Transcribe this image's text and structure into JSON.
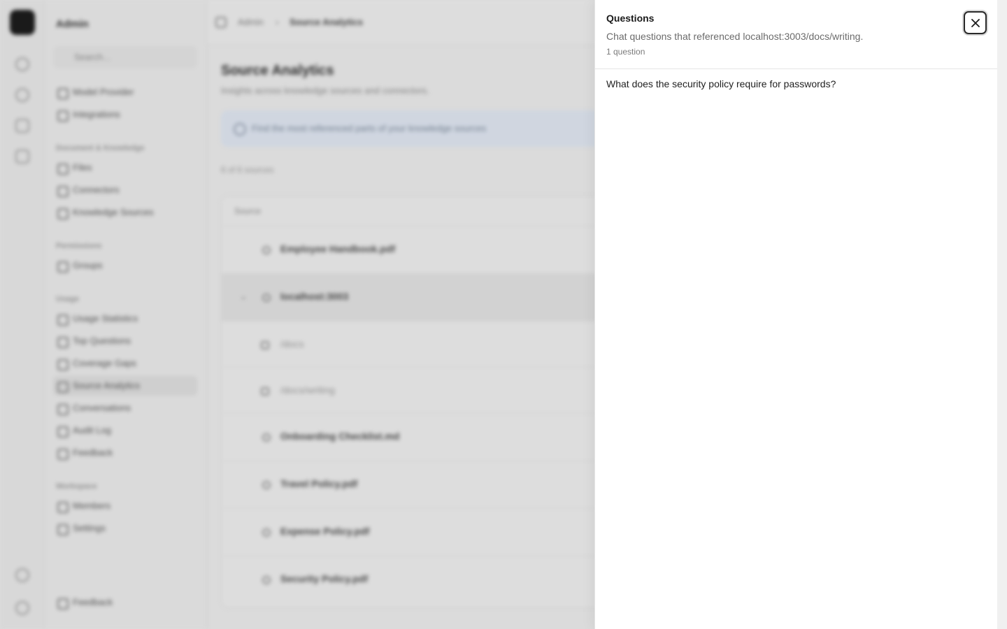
{
  "background": {
    "workspace_name": "Admin",
    "search_placeholder": "Search...",
    "sidebar": {
      "top_items": [
        "Model Provider",
        "Integrations"
      ],
      "sections": [
        {
          "title": "Document & Knowledge",
          "items": [
            "Files",
            "Connectors",
            "Knowledge Sources"
          ]
        },
        {
          "title": "Permissions",
          "items": [
            "Groups"
          ]
        },
        {
          "title": "Usage",
          "items": [
            "Usage Statistics",
            "Top Questions",
            "Coverage Gaps",
            "Source Analytics",
            "Conversations",
            "Audit Log",
            "Feedback"
          ]
        },
        {
          "title": "Workspace",
          "items": [
            "Members",
            "Settings"
          ]
        }
      ],
      "footer_item": "Feedback"
    },
    "breadcrumb": [
      "Admin",
      "Source Analytics"
    ],
    "page_title": "Source Analytics",
    "page_subtitle": "Insights across knowledge sources and connectors.",
    "banner_text": "Find the most referenced parts of your knowledge sources",
    "count_text": "6 of 6 sources",
    "table_header": "Source",
    "rows": [
      {
        "name": "Employee Handbook.pdf",
        "kind": "file"
      },
      {
        "name": "localhost:3003",
        "kind": "site",
        "expanded": true
      },
      {
        "name": "/docs",
        "kind": "child"
      },
      {
        "name": "/docs/writing",
        "kind": "child"
      },
      {
        "name": "Onboarding Checklist.md",
        "kind": "file"
      },
      {
        "name": "Travel Policy.pdf",
        "kind": "file"
      },
      {
        "name": "Expense Policy.pdf",
        "kind": "file"
      },
      {
        "name": "Security Policy.pdf",
        "kind": "file"
      }
    ]
  },
  "sheet": {
    "title": "Questions",
    "description": "Chat questions that referenced localhost:3003/docs/writing.",
    "count": "1 question",
    "close_icon": "close-icon",
    "questions": [
      "What does the security policy require for passwords?"
    ]
  },
  "colors": {
    "sheet_bg": "#ffffff",
    "backdrop": "#e9e9e9",
    "banner_bg": "#dde4ef"
  }
}
